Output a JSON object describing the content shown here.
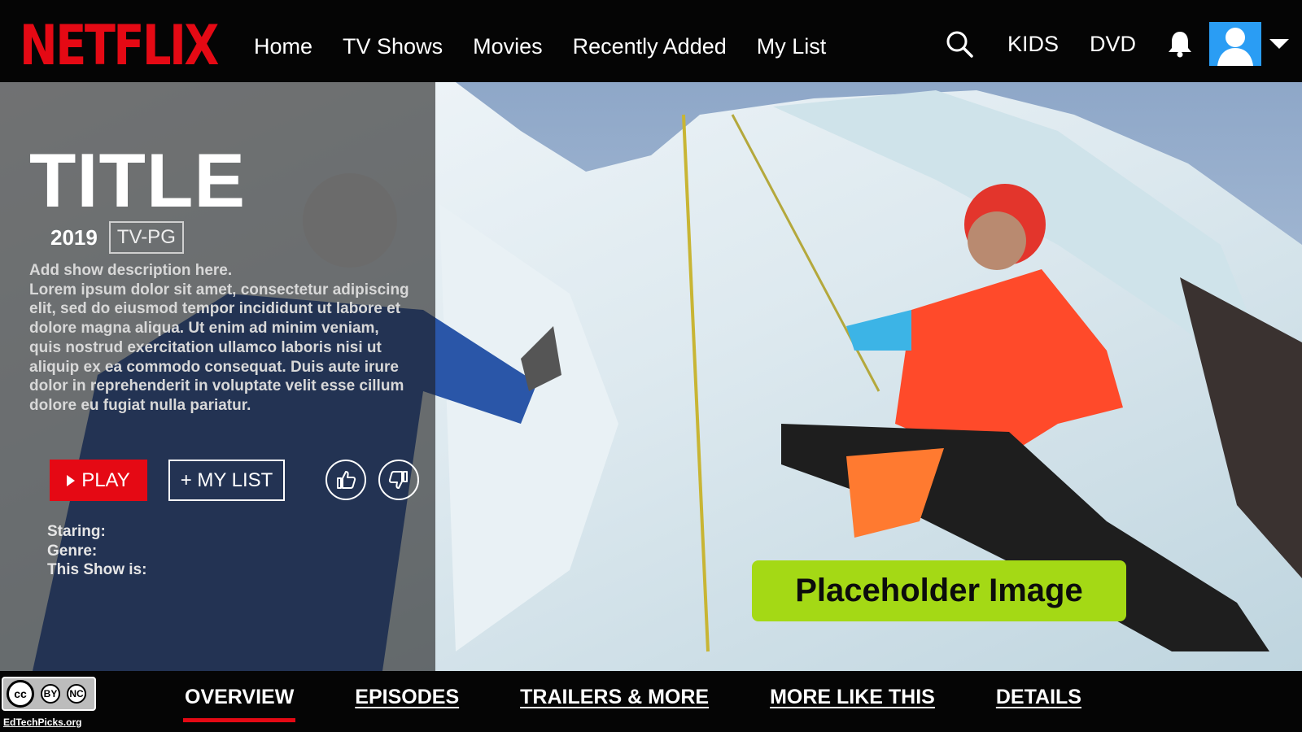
{
  "brand": {
    "logo_text": "NETFLIX",
    "accent": "#e50914"
  },
  "nav": {
    "items": [
      "Home",
      "TV Shows",
      "Movies",
      "Recently Added",
      "My List"
    ],
    "kids_label": "KIDS",
    "dvd_label": "DVD",
    "icons": [
      "search-icon",
      "bell-icon",
      "avatar",
      "chevron-down-icon"
    ]
  },
  "show": {
    "title": "TITLE",
    "year": "2019",
    "rating": "TV-PG",
    "description_lead": "Add show description here.",
    "description_body": "Lorem ipsum dolor sit amet, consectetur adipiscing elit, sed do eiusmod tempor incididunt ut labore et dolore magna aliqua. Ut enim ad minim veniam, quis nostrud exercitation ullamco laboris nisi ut aliquip ex ea commodo consequat. Duis aute irure dolor in reprehenderit in voluptate velit esse cillum dolore eu fugiat nulla pariatur.",
    "play_label": "PLAY",
    "mylist_label": "+ MY LIST",
    "info": {
      "staring": "Staring:",
      "genre": "Genre:",
      "this_show_is": "This Show is:"
    }
  },
  "hero": {
    "placeholder_label": "Placeholder Image",
    "placeholder_color": "#a4d915"
  },
  "tabs": [
    {
      "label": "OVERVIEW",
      "active": true
    },
    {
      "label": "EPISODES",
      "active": false
    },
    {
      "label": "TRAILERS & MORE",
      "active": false
    },
    {
      "label": "MORE LIKE THIS",
      "active": false
    },
    {
      "label": "DETAILS",
      "active": false
    }
  ],
  "license": {
    "badge_text": [
      "cc",
      "BY",
      "NC"
    ],
    "site": "EdTechPicks.org"
  }
}
